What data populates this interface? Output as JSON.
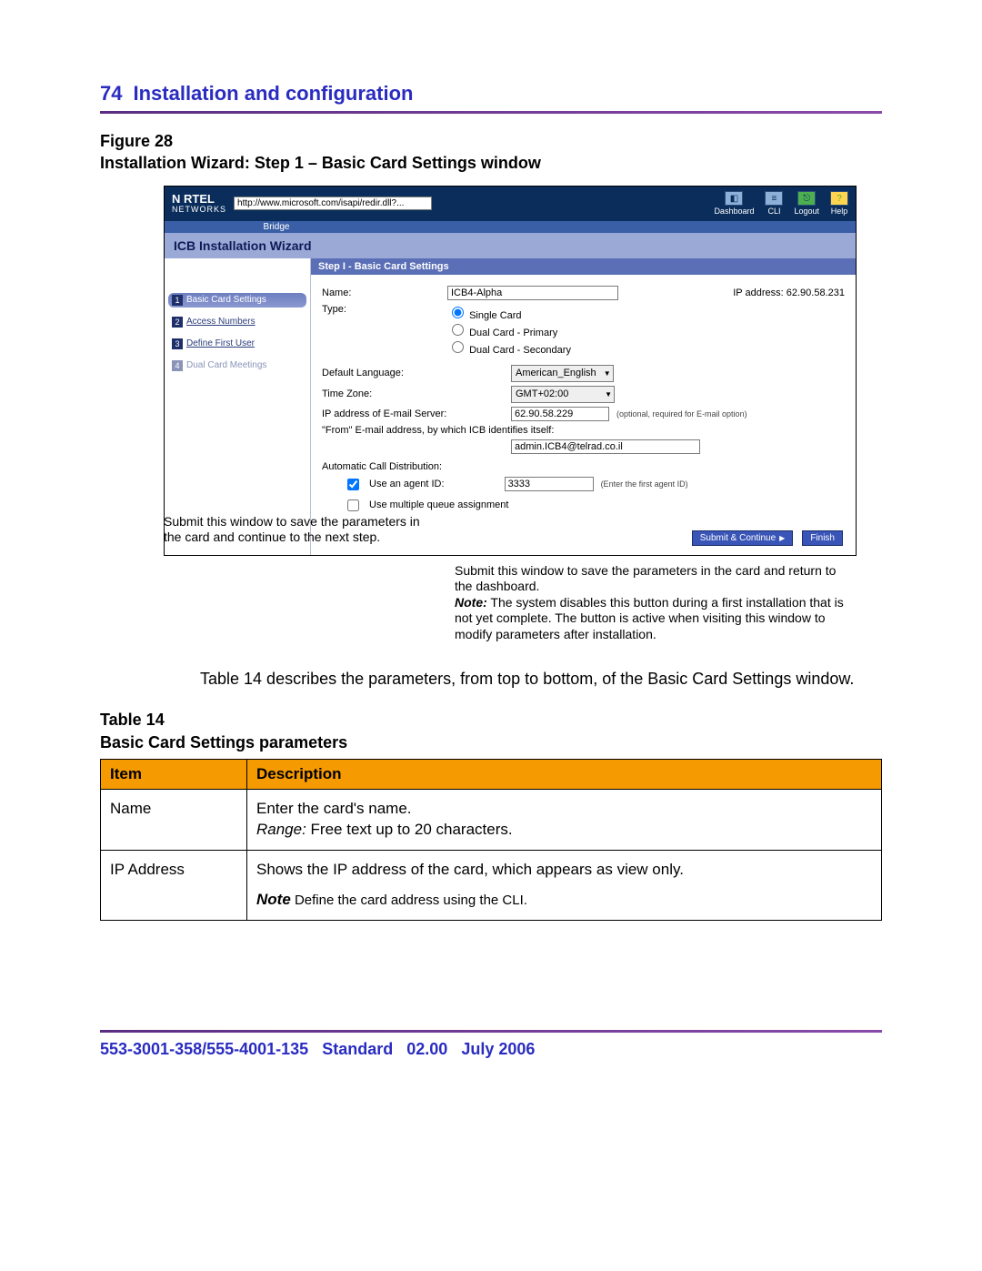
{
  "header": {
    "page_number": "74",
    "section": "Installation and configuration"
  },
  "figure": {
    "label": "Figure 28",
    "title": "Installation Wizard: Step 1 – Basic Card Settings window"
  },
  "screenshot": {
    "brand_top": "N RTEL",
    "brand_sub": "NETWORKS",
    "url": "http://www.microsoft.com/isapi/redir.dll?...",
    "bridge_label": "Bridge",
    "topnav": {
      "dashboard": "Dashboard",
      "cli": "CLI",
      "logout": "Logout",
      "help": "Help"
    },
    "wizard_title": "ICB Installation Wizard",
    "steps": [
      {
        "num": "1",
        "label": "Basic Card Settings"
      },
      {
        "num": "2",
        "label": "Access Numbers"
      },
      {
        "num": "3",
        "label": "Define First User"
      },
      {
        "num": "4",
        "label": "Dual Card Meetings"
      }
    ],
    "main_title": "Step I - Basic Card Settings",
    "labels": {
      "name": "Name:",
      "ip_display_label": "IP address:",
      "ip_display_value": "62.90.58.231",
      "type": "Type:",
      "type_options": {
        "single": "Single Card",
        "dual_primary": "Dual Card - Primary",
        "dual_secondary": "Dual Card - Secondary"
      },
      "default_language": "Default Language:",
      "time_zone": "Time Zone:",
      "ip_email": "IP address of E-mail Server:",
      "ip_email_hint": "(optional, required for E-mail option)",
      "from_email": "\"From\" E-mail address, by which ICB identifies itself:",
      "acd_title": "Automatic Call Distribution:",
      "use_agent": "Use an agent ID:",
      "agent_hint": "(Enter the first agent ID)",
      "multi_queue": "Use multiple queue assignment"
    },
    "values": {
      "name": "ICB4-Alpha",
      "language": "American_English",
      "tz": "GMT+02:00",
      "ip_email": "62.90.58.229",
      "from_email": "admin.ICB4@telrad.co.il",
      "agent_id": "3333"
    },
    "buttons": {
      "submit_continue": "Submit & Continue",
      "finish": "Finish"
    }
  },
  "callouts": {
    "left": "Submit this window to save the parameters in the card and continue to the next step.",
    "right_main": "Submit this window to save the parameters in the card and return to the dashboard.",
    "right_note_label": "Note:",
    "right_note": " The system disables this button during a first installation that is not yet complete. The button is active when visiting this window to modify parameters after installation."
  },
  "body_after_figure": "Table 14 describes the parameters, from top to bottom, of the Basic Card Settings window.",
  "table": {
    "label": "Table 14",
    "title": "Basic Card Settings parameters",
    "headers": {
      "item": "Item",
      "desc": "Description"
    },
    "rows": [
      {
        "item": "Name",
        "desc_line1": "Enter the card's name.",
        "range_label": "Range:",
        "range_text": " Free text up to 20 characters."
      },
      {
        "item": "IP Address",
        "desc_line1": "Shows the IP address of the card, which appears as view only.",
        "note_label": "Note",
        "note_text": "  Define the card address using the CLI."
      }
    ]
  },
  "footer": {
    "doc": "553-3001-358/555-4001-135",
    "standard": "Standard",
    "ver": "02.00",
    "date": "July 2006"
  }
}
